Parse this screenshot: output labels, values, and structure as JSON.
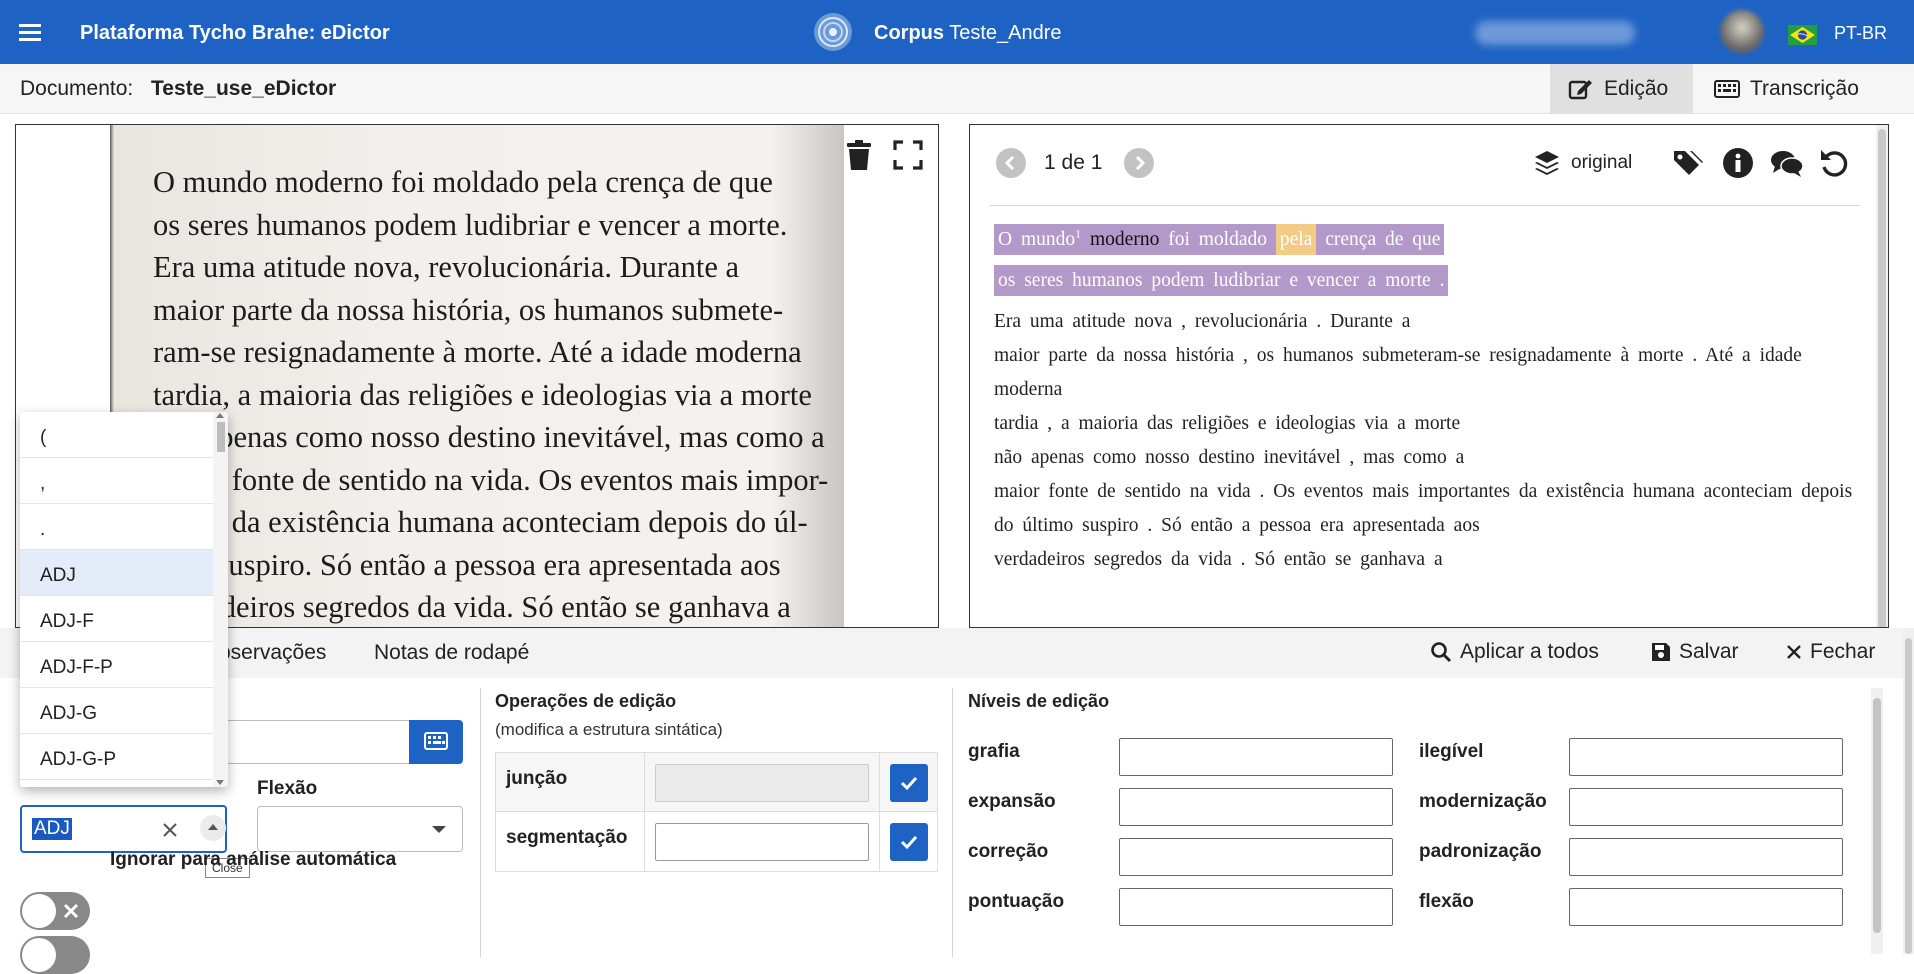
{
  "header": {
    "app_title": "Plataforma Tycho Brahe: eDictor",
    "corpus_prefix": "Corpus",
    "corpus_name": "Teste_Andre",
    "language": "PT-BR"
  },
  "document": {
    "label": "Documento:",
    "name": "Teste_use_eDictor",
    "tabs": [
      {
        "label": "Edição",
        "active": true,
        "icon": "edit-icon"
      },
      {
        "label": "Transcrição",
        "active": false,
        "icon": "keyboard-icon"
      }
    ]
  },
  "image_page": {
    "lines": [
      "O mundo moderno foi moldado pela crença de que",
      "os seres humanos podem ludibriar e vencer a morte.",
      "Era uma atitude nova, revolucionária. Durante a",
      "maior parte da nossa história, os humanos submete-",
      "ram-se resignadamente à morte. Até a idade moderna",
      "tardia, a maioria das religiões e ideologias via a morte",
      "não apenas como nosso destino inevitável, mas como a",
      "maior fonte de sentido na vida. Os eventos mais impor-",
      "tantes da existência humana aconteciam depois do úl-",
      "timo suspiro. Só então a pessoa era apresentada aos",
      "verdadeiros segredos da vida. Só então se ganhava a"
    ]
  },
  "text_panel": {
    "pager": "1 de 1",
    "layer_label": "original",
    "line1": {
      "w1": "O",
      "w2": "mundo",
      "sup": "1",
      "w3": "moderno",
      "w4": "foi",
      "w5": "moldado",
      "w6": "pela",
      "w7": "crença de que"
    },
    "line2": "os seres humanos podem ludibriar e vencer a morte .",
    "lines": [
      "Era uma atitude nova , revolucionária . Durante a",
      "maior parte da nossa história , os humanos submeteram-se resignadamente à morte . Até a idade moderna",
      "tardia , a maioria das religiões e ideologias via a morte",
      "não apenas como nosso destino inevitável , mas como a",
      "maior fonte de sentido na vida . Os eventos mais importantes da existência humana aconteciam depois do último suspiro . Só então a pessoa era apresentada aos",
      "verdadeiros segredos da vida . Só então se ganhava a"
    ]
  },
  "bottom_tabs": {
    "observations_partial": "bservações",
    "footnotes": "Notas de rodapé",
    "apply_all": "Aplicar a todos",
    "save": "Salvar",
    "close": "Fechar"
  },
  "morph": {
    "flexion_label": "Flexão",
    "tag_value": "ADJ",
    "tooltip": "Close",
    "ignore_label": "Ignorar para análise automática"
  },
  "tag_options": [
    "(",
    ",",
    ".",
    "ADJ",
    "ADJ-F",
    "ADJ-F-P",
    "ADJ-G",
    "ADJ-G-P"
  ],
  "edit_ops": {
    "title": "Operações de edição",
    "subtitle": "(modifica a estrutura sintática)",
    "rows": [
      {
        "name": "junção"
      },
      {
        "name": "segmentação"
      }
    ]
  },
  "levels": {
    "title": "Níveis de edição",
    "left": [
      "grafia",
      "expansão",
      "correção",
      "pontuação"
    ],
    "right": [
      "ilegível",
      "modernização",
      "padronização",
      "flexão"
    ]
  },
  "colors": {
    "primary": "#1e63c4",
    "highlight_purple": "#b399c9",
    "highlight_yellow": "#f2cb85"
  }
}
